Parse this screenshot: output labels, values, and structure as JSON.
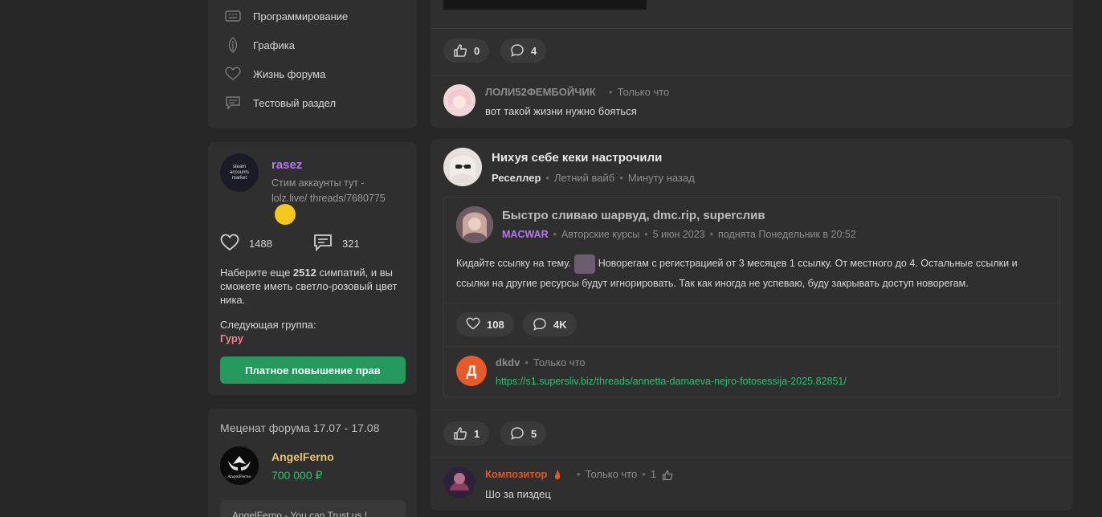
{
  "categories": [
    {
      "label": "Программирование",
      "icon": "keyboard-icon"
    },
    {
      "label": "Графика",
      "icon": "leaf-icon"
    },
    {
      "label": "Жизнь форума",
      "icon": "heart-icon"
    },
    {
      "label": "Тестовый раздел",
      "icon": "chat-icon"
    }
  ],
  "profile": {
    "avatar_text": "steam accounts market",
    "name": "rasez",
    "status": "Стим аккаунты тут - lolz.live/ threads/7680775",
    "likes": "1488",
    "messages": "321",
    "sympathy_prefix": "Наберите еще ",
    "sympathy_count": "2512",
    "sympathy_suffix": " симпатий, и вы сможете иметь светло-розовый цвет ника.",
    "next_group_label": "Следующая группа:",
    "next_group": "Гуру",
    "upgrade_button": "Платное повышение прав"
  },
  "patron": {
    "title": "Меценат форума 17.07 - 17.08",
    "name": "AngelFerno",
    "amount": "700 000 ₽",
    "quote": "AngelFerno - You can Trust us !",
    "avatar_text": "AngelFerno"
  },
  "post_top": {
    "likes": "0",
    "comments": "4",
    "comment": {
      "author": "ЛОЛИ52ФЕМБОЙЧИК",
      "time": "Только что",
      "text": "вот такой жизни нужно бояться"
    }
  },
  "post_main": {
    "title": "Нихуя себе кеки настрочили",
    "author_group": "Реселлер",
    "section": "Летний вайб",
    "time": "Минуту назад",
    "quoted": {
      "title": "Быстро сливаю шарвуд, dmc.rip, superслив",
      "author": "MACWAR",
      "section": "Авторские курсы",
      "date": "5 июн 2023",
      "bumped": "поднята Понедельник в 20:52",
      "text_part1": "Кидайте ссылку на тему.",
      "text_part2": "Новорегам с регистрацией от 3 месяцев 1 ссылку. От местного до 4. Остальные ссылки и ссылки на другие ресурсы будут игнорировать. Так как иногда не успеваю, буду закрывать доступ новорегам.",
      "likes": "108",
      "comments": "4K",
      "comment": {
        "avatar_letter": "Д",
        "author": "dkdv",
        "time": "Только что",
        "link": "https://s1.supersliv.biz/threads/annetta-damaeva-nejro-fotosessija-2025.82851/"
      }
    },
    "likes": "1",
    "comments": "5",
    "comment": {
      "author": "Композитор",
      "time": "Только что",
      "likes": "1",
      "text": "Шо за пиздец"
    }
  },
  "colors": {
    "background": "#272727",
    "panel": "#2f2f2f",
    "accent_green": "#239a5c",
    "nick_purple": "#b776f5",
    "link_green": "#2fbf71",
    "group_pink": "#ff7a8a"
  }
}
